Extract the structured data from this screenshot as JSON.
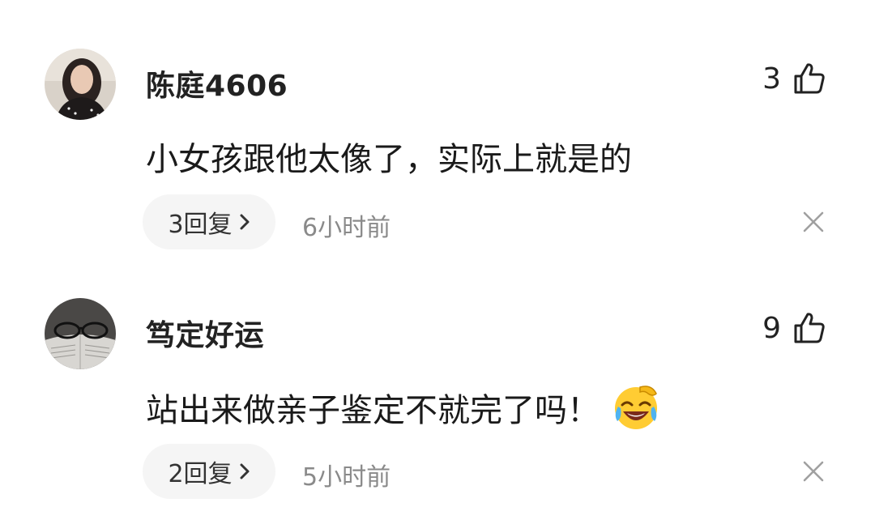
{
  "comments": [
    {
      "username": "陈庭4606",
      "likes": "3",
      "text": "小女孩跟他太像了，实际上就是的",
      "reply_label": "3回复",
      "time": "6小时前",
      "avatar_icon": "user-photo-avatar",
      "has_emoji": false
    },
    {
      "username": "笃定好运",
      "likes": "9",
      "text": "站出来做亲子鉴定不就完了吗！",
      "reply_label": "2回复",
      "time": "5小时前",
      "avatar_icon": "glasses-on-book-avatar",
      "has_emoji": true,
      "emoji_icon": "laughing-crying-emoji"
    }
  ],
  "icons": {
    "like": "thumbs-up-icon",
    "close": "close-icon",
    "chevron": "chevron-right-icon"
  },
  "colors": {
    "username": "#222222",
    "text": "#1a1a1a",
    "secondary": "#8a8a8a",
    "reply_bg": "#f5f5f5"
  }
}
